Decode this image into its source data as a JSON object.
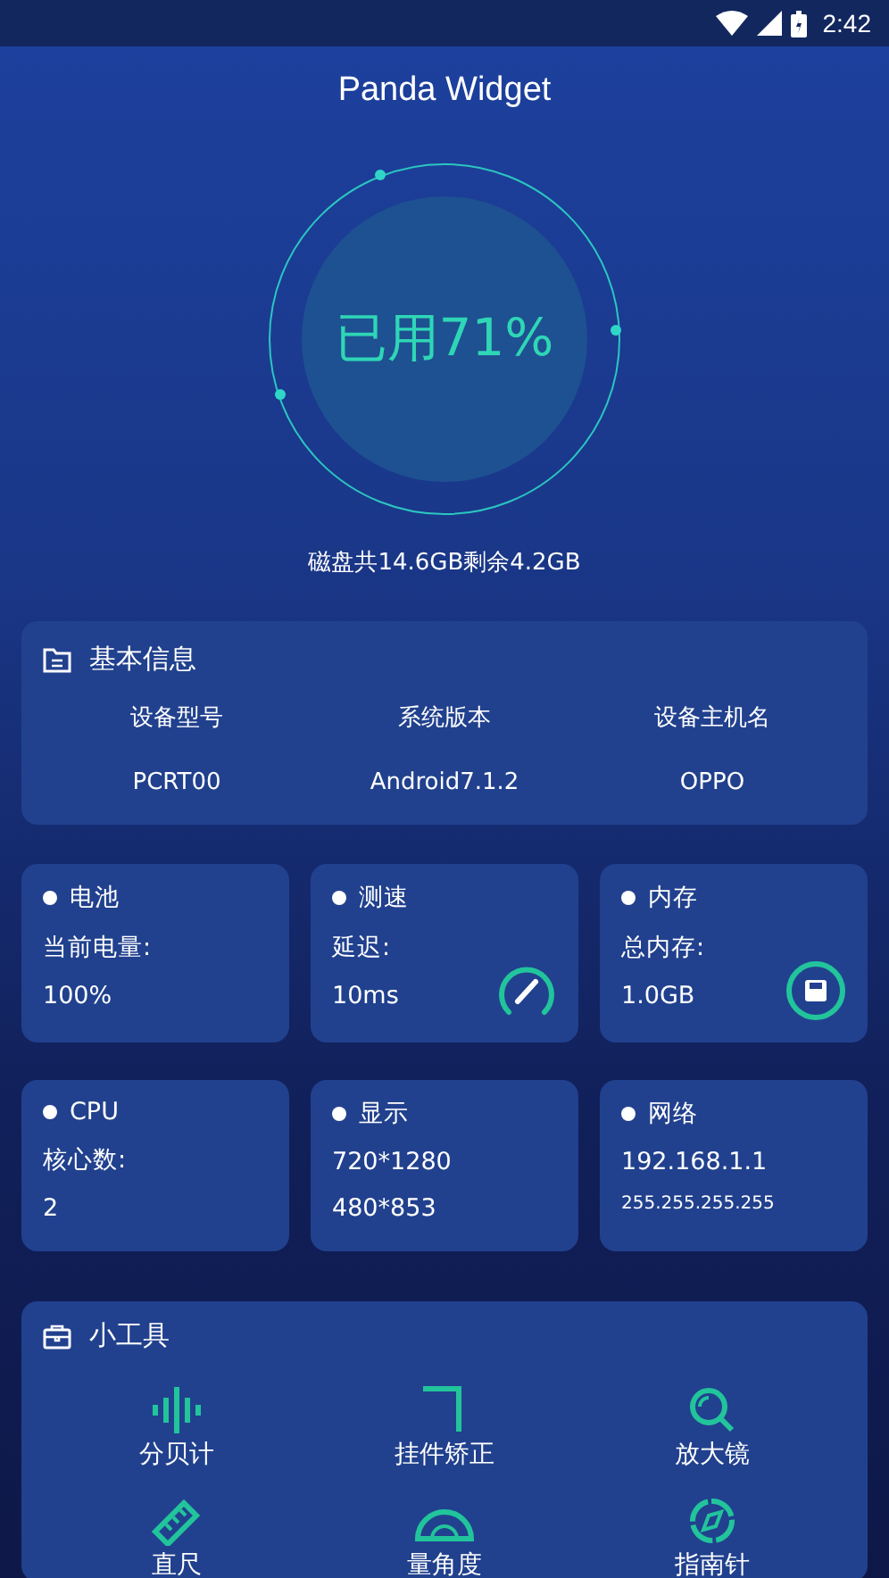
{
  "status_bar": {
    "time": "2:42"
  },
  "title": "Panda Widget",
  "disk": {
    "usage": "已用71%",
    "summary": "磁盘共14.6GB剩余4.2GB"
  },
  "basic_info": {
    "title": "基本信息",
    "columns": [
      {
        "label": "设备型号",
        "value": "PCRT00"
      },
      {
        "label": "系统版本",
        "value": "Android7.1.2"
      },
      {
        "label": "设备主机名",
        "value": "OPPO"
      }
    ]
  },
  "stat_cards": [
    {
      "title": "电池",
      "lines": [
        "当前电量:",
        "100%"
      ]
    },
    {
      "title": "测速",
      "lines": [
        "延迟:",
        "10ms"
      ]
    },
    {
      "title": "内存",
      "lines": [
        "总内存:",
        "1.0GB"
      ]
    },
    {
      "title": "CPU",
      "lines": [
        "核心数:",
        "2"
      ]
    },
    {
      "title": "显示",
      "lines": [
        "720*1280",
        "480*853"
      ]
    },
    {
      "title": "网络",
      "lines": [
        "192.168.1.1",
        "255.255.255.255"
      ]
    }
  ],
  "tools": {
    "title": "小工具",
    "items": [
      {
        "label": "分贝计"
      },
      {
        "label": "挂件矫正"
      },
      {
        "label": "放大镜"
      },
      {
        "label": "直尺"
      },
      {
        "label": "量角度"
      },
      {
        "label": "指南针"
      }
    ]
  }
}
